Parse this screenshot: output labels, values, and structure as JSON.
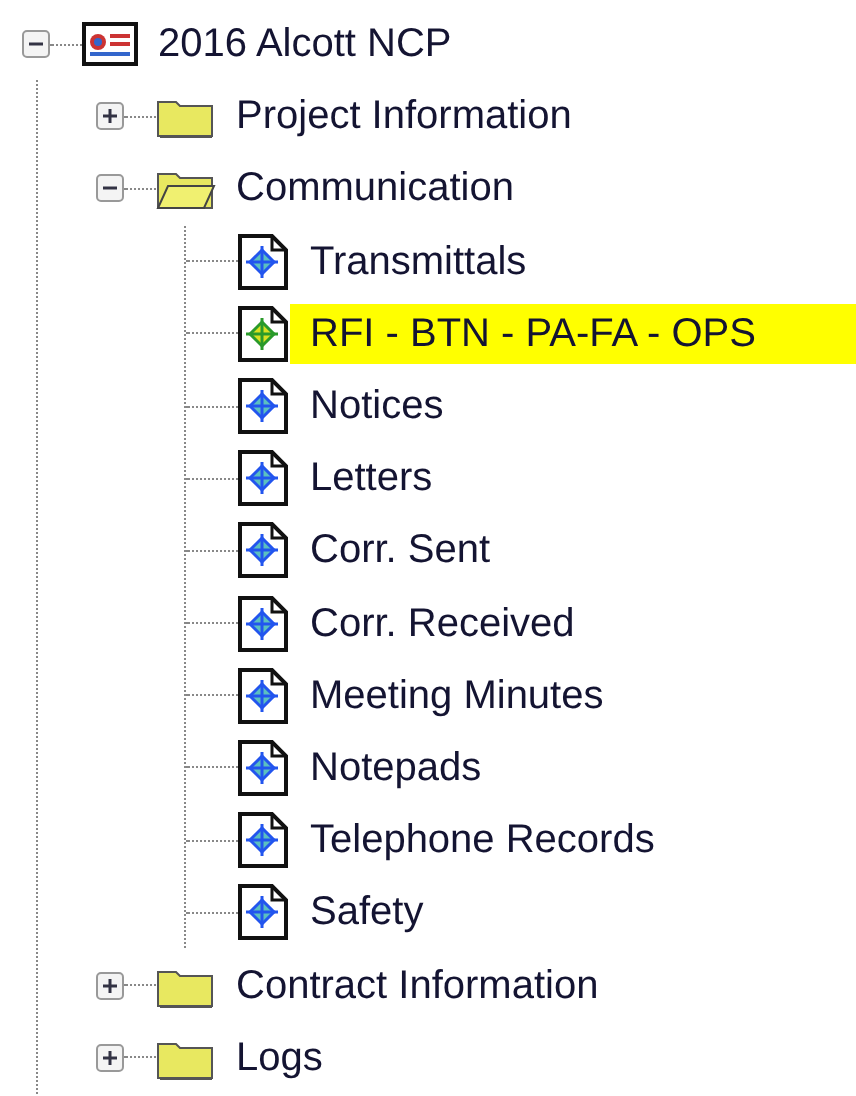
{
  "tree": [
    {
      "kind": "project",
      "label": "2016 Alcott NCP",
      "expanded": true,
      "selected": false,
      "children": [
        {
          "kind": "folder",
          "label": "Project Information",
          "expanded": false,
          "selected": false
        },
        {
          "kind": "folder",
          "label": "Communication",
          "expanded": true,
          "selected": false,
          "children": [
            {
              "kind": "document",
              "label": "Transmittals",
              "selected": false
            },
            {
              "kind": "document",
              "label": "RFI - BTN - PA-FA - OPS",
              "selected": true
            },
            {
              "kind": "document",
              "label": "Notices",
              "selected": false
            },
            {
              "kind": "document",
              "label": "Letters",
              "selected": false
            },
            {
              "kind": "document",
              "label": "Corr. Sent",
              "selected": false
            },
            {
              "kind": "document",
              "label": "Corr. Received",
              "selected": false
            },
            {
              "kind": "document",
              "label": "Meeting Minutes",
              "selected": false
            },
            {
              "kind": "document",
              "label": "Notepads",
              "selected": false
            },
            {
              "kind": "document",
              "label": "Telephone Records",
              "selected": false
            },
            {
              "kind": "document",
              "label": "Safety",
              "selected": false
            }
          ]
        },
        {
          "kind": "folder",
          "label": "Contract Information",
          "expanded": false,
          "selected": false
        },
        {
          "kind": "folder",
          "label": "Logs",
          "expanded": false,
          "selected": false
        }
      ]
    }
  ]
}
